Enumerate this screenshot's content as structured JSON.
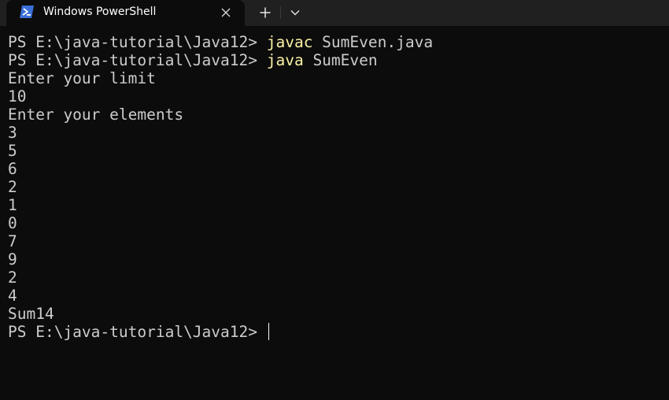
{
  "tab": {
    "title": "Windows PowerShell",
    "icon": "powershell-icon",
    "close_icon": "close-icon"
  },
  "toolbar": {
    "new_tab_icon": "plus-icon",
    "dropdown_icon": "chevron-down-icon"
  },
  "colors": {
    "background": "#0c0c0c",
    "tab_bar": "#202020",
    "text": "#cccccc",
    "command": "#f9f1a5",
    "powershell_icon": "#3a6fd8"
  },
  "terminal": {
    "prompt": "PS E:\\java-tutorial\\Java12> ",
    "lines": [
      {
        "prompt": "PS E:\\java-tutorial\\Java12> ",
        "cmd": "javac",
        "args": " SumEven.java"
      },
      {
        "prompt": "PS E:\\java-tutorial\\Java12> ",
        "cmd": "java",
        "args": " SumEven"
      },
      {
        "text": "Enter your limit"
      },
      {
        "text": "10"
      },
      {
        "text": "Enter your elements"
      },
      {
        "text": "3"
      },
      {
        "text": "5"
      },
      {
        "text": "6"
      },
      {
        "text": "2"
      },
      {
        "text": "1"
      },
      {
        "text": "0"
      },
      {
        "text": "7"
      },
      {
        "text": "9"
      },
      {
        "text": "2"
      },
      {
        "text": "4"
      },
      {
        "text": "Sum14"
      },
      {
        "prompt": "PS E:\\java-tutorial\\Java12> ",
        "cursor": true
      }
    ]
  }
}
